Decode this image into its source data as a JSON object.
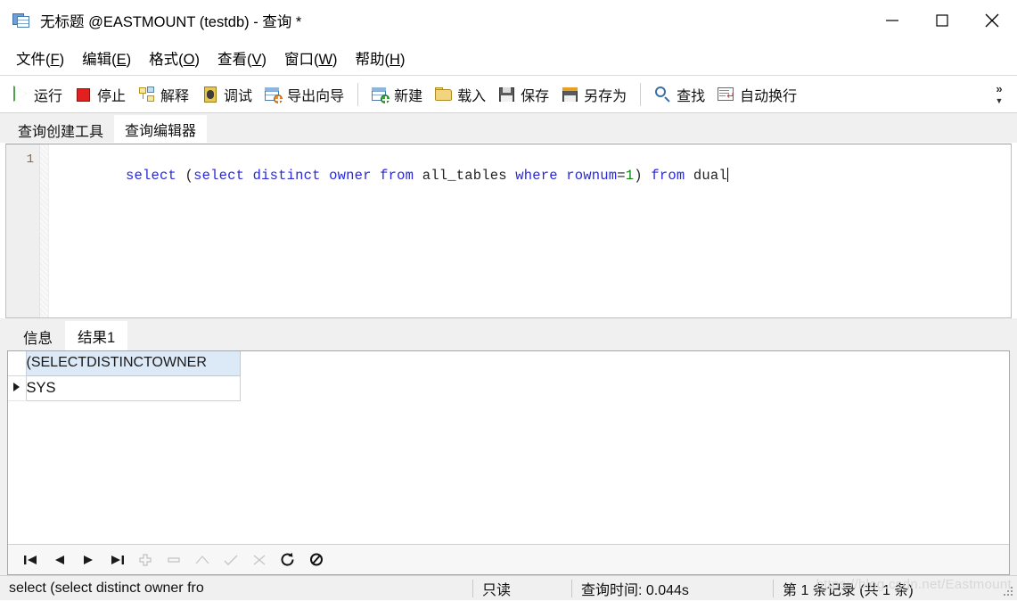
{
  "window": {
    "title": "无标题 @EASTMOUNT (testdb) - 查询 *",
    "icon": "query-window-icon",
    "controls": {
      "minimize": "minimize-icon",
      "maximize": "maximize-icon",
      "close": "close-icon"
    }
  },
  "menubar": {
    "items": [
      {
        "label": "文件(F)",
        "text": "文件",
        "key": "F"
      },
      {
        "label": "编辑(E)",
        "text": "编辑",
        "key": "E"
      },
      {
        "label": "格式(O)",
        "text": "格式",
        "key": "O"
      },
      {
        "label": "查看(V)",
        "text": "查看",
        "key": "V"
      },
      {
        "label": "窗口(W)",
        "text": "窗口",
        "key": "W"
      },
      {
        "label": "帮助(H)",
        "text": "帮助",
        "key": "H"
      }
    ]
  },
  "toolbar": {
    "group1": [
      {
        "label": "运行",
        "icon": "run-icon"
      },
      {
        "label": "停止",
        "icon": "stop-icon"
      },
      {
        "label": "解释",
        "icon": "explain-icon"
      },
      {
        "label": "调试",
        "icon": "debug-icon"
      },
      {
        "label": "导出向导",
        "icon": "export-wizard-icon"
      }
    ],
    "group2": [
      {
        "label": "新建",
        "icon": "new-icon"
      },
      {
        "label": "载入",
        "icon": "open-icon"
      },
      {
        "label": "保存",
        "icon": "save-icon"
      },
      {
        "label": "另存为",
        "icon": "save-as-icon"
      }
    ],
    "group3": [
      {
        "label": "查找",
        "icon": "search-icon"
      },
      {
        "label": "自动换行",
        "icon": "word-wrap-icon"
      }
    ],
    "overflow": {
      "chevrons": "»",
      "caret": "▼"
    }
  },
  "editor_tabs": [
    {
      "label": "查询创建工具",
      "active": false
    },
    {
      "label": "查询编辑器",
      "active": true
    }
  ],
  "editor": {
    "line_number": "1",
    "sql_tokens": [
      {
        "t": "select",
        "k": "kw"
      },
      {
        "t": " ",
        "k": "punct"
      },
      {
        "t": "(",
        "k": "punct"
      },
      {
        "t": "select",
        "k": "kw"
      },
      {
        "t": " ",
        "k": "punct"
      },
      {
        "t": "distinct",
        "k": "kw"
      },
      {
        "t": " ",
        "k": "punct"
      },
      {
        "t": "owner",
        "k": "kw"
      },
      {
        "t": " ",
        "k": "punct"
      },
      {
        "t": "from",
        "k": "kw"
      },
      {
        "t": " ",
        "k": "punct"
      },
      {
        "t": "all_tables",
        "k": "id"
      },
      {
        "t": " ",
        "k": "punct"
      },
      {
        "t": "where",
        "k": "kw"
      },
      {
        "t": " ",
        "k": "punct"
      },
      {
        "t": "rownum",
        "k": "kw"
      },
      {
        "t": "=",
        "k": "punct"
      },
      {
        "t": "1",
        "k": "num"
      },
      {
        "t": ")",
        "k": "punct"
      },
      {
        "t": " ",
        "k": "punct"
      },
      {
        "t": "from",
        "k": "kw"
      },
      {
        "t": " ",
        "k": "punct"
      },
      {
        "t": "dual",
        "k": "id"
      }
    ],
    "sql_text": "select (select distinct owner from all_tables where rownum=1) from dual",
    "annotation": {
      "type": "red-arrow",
      "color": "#f23030",
      "direction": "up"
    }
  },
  "result_tabs": [
    {
      "label": "信息",
      "active": false
    },
    {
      "label": "结果1",
      "active": true
    }
  ],
  "grid": {
    "columns": [
      "(SELECTDISTINCTOWNER"
    ],
    "rows": [
      {
        "indicator": "current-row-icon",
        "values": [
          "SYS"
        ]
      }
    ],
    "nav": [
      {
        "icon": "first-record-icon",
        "enabled": true
      },
      {
        "icon": "prev-record-icon",
        "enabled": true
      },
      {
        "icon": "next-record-icon",
        "enabled": true
      },
      {
        "icon": "last-record-icon",
        "enabled": true
      },
      {
        "icon": "add-record-icon",
        "enabled": false
      },
      {
        "icon": "delete-record-icon",
        "enabled": false
      },
      {
        "icon": "edit-record-icon",
        "enabled": false
      },
      {
        "icon": "post-edit-icon",
        "enabled": false
      },
      {
        "icon": "cancel-edit-icon",
        "enabled": false
      },
      {
        "icon": "refresh-icon",
        "enabled": true
      },
      {
        "icon": "stop-loading-icon",
        "enabled": true
      }
    ]
  },
  "statusbar": {
    "sql_preview": "select (select distinct owner fro",
    "readonly": "只读",
    "query_time": "查询时间: 0.044s",
    "record_position": "第 1 条记录 (共 1 条)",
    "watermark": "https://blog.csdn.net/Eastmount"
  },
  "colors": {
    "keyword": "#2a2ad8",
    "number": "#0b8a0b",
    "header_fill": "#dce9f7",
    "accent_red": "#f23030",
    "run_green": "#5bb75b",
    "stop_red": "#e32020"
  }
}
